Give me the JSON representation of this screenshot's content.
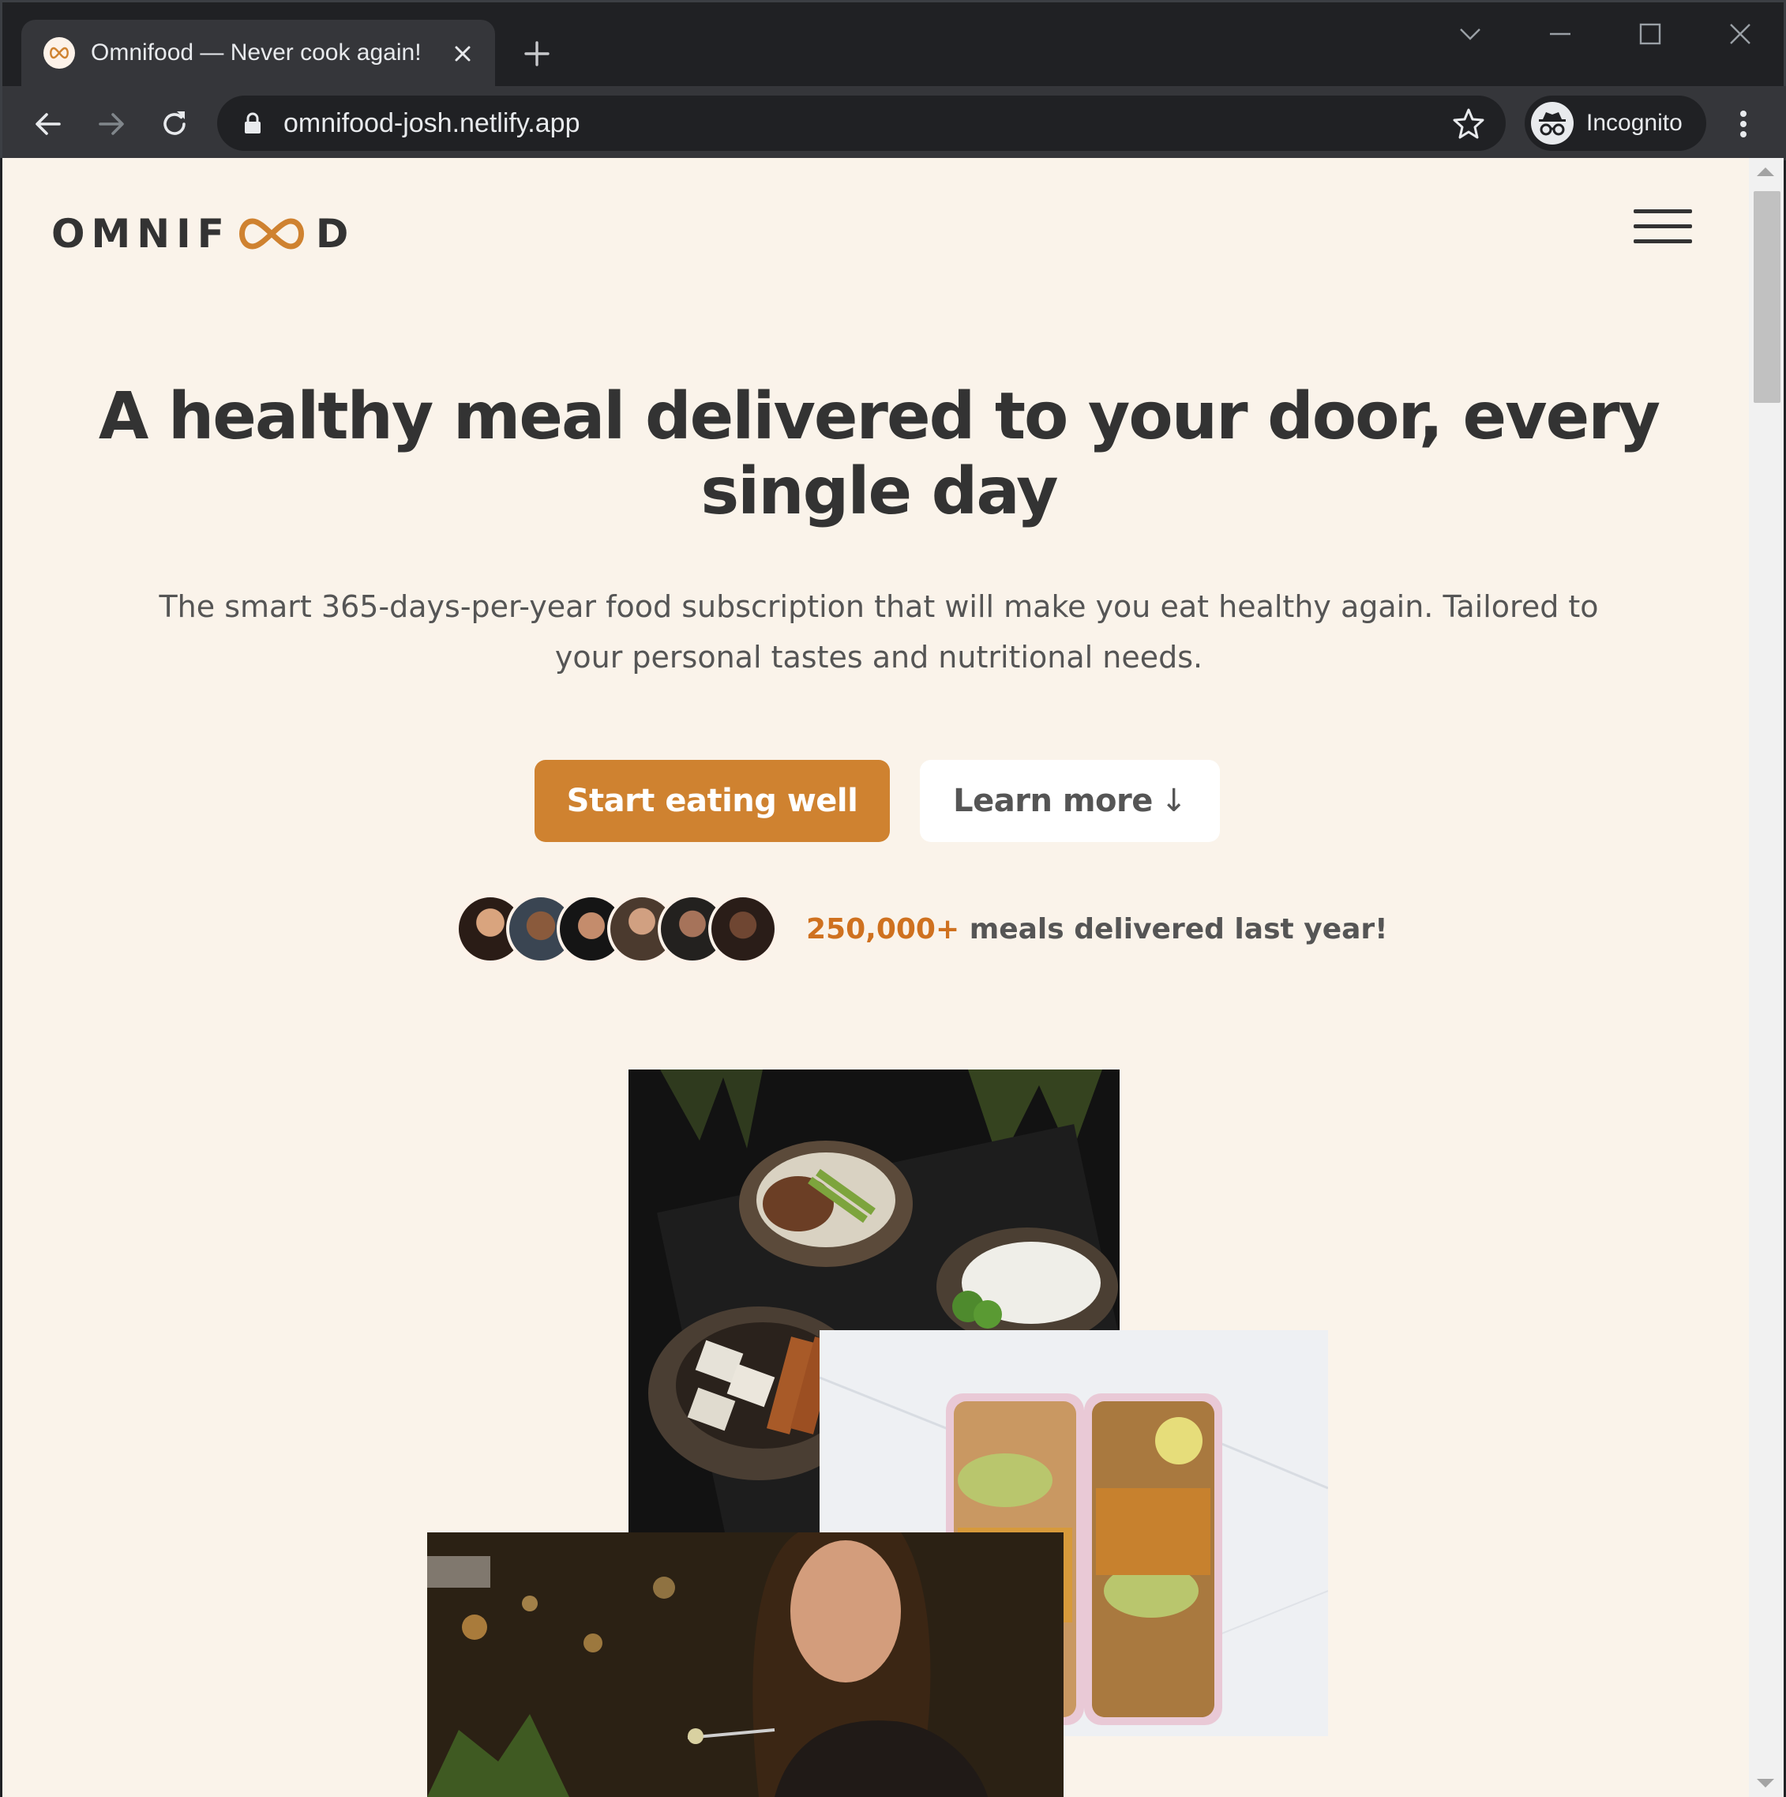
{
  "browser": {
    "tab_title": "Omnifood — Never cook again!",
    "url": "omnifood-josh.netlify.app",
    "incognito_label": "Incognito"
  },
  "page": {
    "logo_text_left": "OMNIF",
    "logo_text_right": "D",
    "headline": "A healthy meal delivered to your door, every single day",
    "subhead": "The smart 365-days-per-year food subscription that will make you eat healthy again. Tailored to your personal tastes and nutritional needs.",
    "cta_primary": "Start eating well",
    "cta_secondary": "Learn more",
    "cta_secondary_arrow": "↓",
    "delivered_count": "250,000+",
    "delivered_text": "meals delivered last year!"
  },
  "colors": {
    "brand": "#cf8230",
    "page_bg": "#faf3ea",
    "text_dark": "#333333"
  },
  "icons": [
    "favicon-infinity-icon",
    "close-icon",
    "plus-icon",
    "chevron-down-icon",
    "minimize-icon",
    "maximize-icon",
    "window-close-icon",
    "back-arrow-icon",
    "forward-arrow-icon",
    "reload-icon",
    "lock-icon",
    "star-icon",
    "incognito-icon",
    "kebab-menu-icon",
    "hamburger-menu-icon"
  ]
}
